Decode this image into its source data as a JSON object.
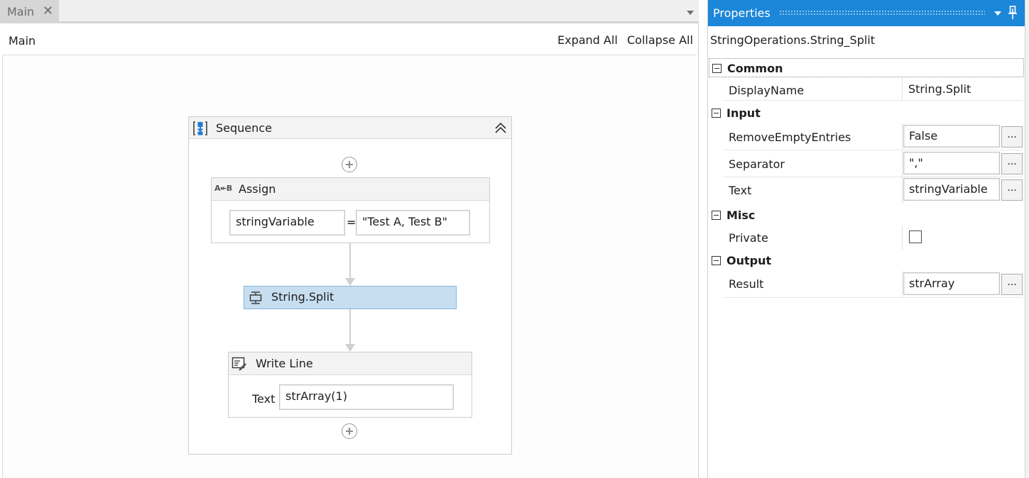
{
  "tabs": {
    "main_label": "Main",
    "close_glyph": "✕"
  },
  "designer": {
    "breadcrumb": "Main",
    "expand_all": "Expand All",
    "collapse_all": "Collapse All",
    "sequence": {
      "title": "Sequence"
    },
    "assign": {
      "title": "Assign",
      "icon_text": "A↞B",
      "to_value": "stringVariable",
      "equals": "=",
      "value": "\"Test A, Test B\""
    },
    "split": {
      "title": "String.Split"
    },
    "writeline": {
      "title": "Write Line",
      "text_label": "Text",
      "text_value": "strArray(1)"
    }
  },
  "properties": {
    "title": "Properties",
    "selected_type": "StringOperations.String_Split",
    "categories": {
      "common": "Common",
      "input": "Input",
      "misc": "Misc",
      "output": "Output"
    },
    "rows": {
      "display_name": {
        "name": "DisplayName",
        "value": "String.Split"
      },
      "remove_empty": {
        "name": "RemoveEmptyEntries",
        "value": "False"
      },
      "separator": {
        "name": "Separator",
        "value": "\",\""
      },
      "text": {
        "name": "Text",
        "value": "stringVariable"
      },
      "private": {
        "name": "Private",
        "checked": false
      },
      "result": {
        "name": "Result",
        "value": "strArray"
      }
    },
    "ellipsis": "..."
  },
  "colors": {
    "accent": "#1c86d8",
    "selected_activity": "#c6def0",
    "selected_activity_border": "#84b5dc"
  }
}
